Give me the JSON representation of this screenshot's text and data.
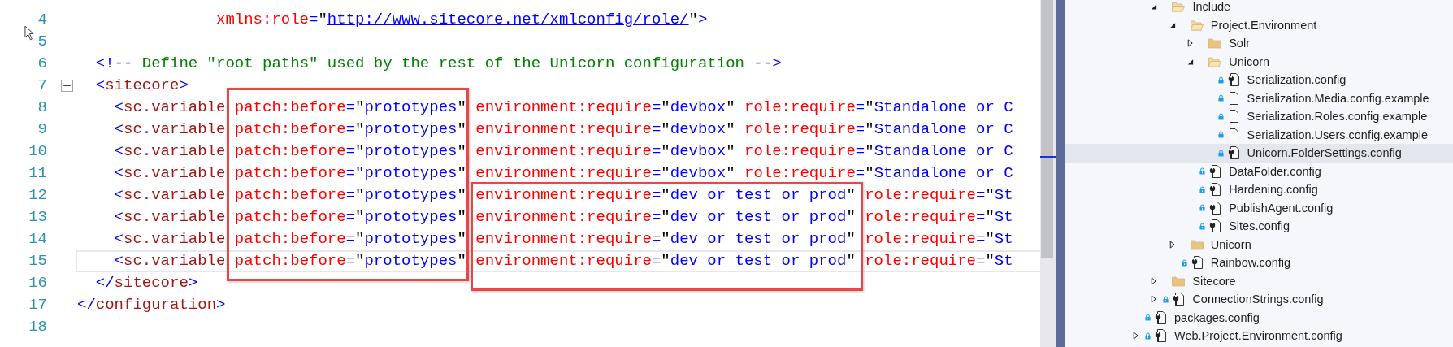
{
  "editor": {
    "lines": [
      {
        "number": "4",
        "current": false,
        "tokens": [
          {
            "kind": "attr",
            "text": "xmlns:role"
          },
          {
            "kind": "delim",
            "text": "="
          },
          {
            "kind": "plain",
            "text": "\""
          },
          {
            "kind": "url",
            "text": "http://www.sitecore.net/xmlconfig/role/"
          },
          {
            "kind": "plain",
            "text": "\""
          },
          {
            "kind": "delim",
            "text": ">"
          }
        ]
      },
      {
        "number": "5",
        "current": false
      },
      {
        "number": "6",
        "current": false,
        "tokens": [
          {
            "kind": "delim",
            "text": "<!--"
          },
          {
            "kind": "comment",
            "text": " Define \"root paths\" used by the rest of the Unicorn configuration "
          },
          {
            "kind": "delim",
            "text": "-->"
          }
        ]
      },
      {
        "number": "7",
        "current": false,
        "fold_expanded": true,
        "tokens": [
          {
            "kind": "delim",
            "text": "<"
          },
          {
            "kind": "tag",
            "text": "sitecore"
          },
          {
            "kind": "delim",
            "text": ">"
          }
        ]
      },
      {
        "number": "8",
        "current": false,
        "tokens": [
          {
            "kind": "delim",
            "text": "<"
          },
          {
            "kind": "tag",
            "text": "sc.variable"
          },
          {
            "kind": "attr",
            "text": "patch:before"
          },
          {
            "kind": "delim",
            "text": "="
          },
          {
            "kind": "plain",
            "text": "\""
          },
          {
            "kind": "value",
            "text": "prototypes"
          },
          {
            "kind": "plain",
            "text": "\" "
          },
          {
            "kind": "attr",
            "text": "environment:require"
          },
          {
            "kind": "delim",
            "text": "="
          },
          {
            "kind": "plain",
            "text": "\""
          },
          {
            "kind": "value",
            "text": "devbox"
          },
          {
            "kind": "plain",
            "text": "\" "
          },
          {
            "kind": "attr",
            "text": "role:require"
          },
          {
            "kind": "delim",
            "text": "="
          },
          {
            "kind": "plain",
            "text": "\""
          },
          {
            "kind": "value",
            "text": "Standalone or C"
          }
        ]
      },
      {
        "number": "9",
        "current": false,
        "tokens": [
          {
            "kind": "delim",
            "text": "<"
          },
          {
            "kind": "tag",
            "text": "sc.variable"
          },
          {
            "kind": "attr",
            "text": "patch:before"
          },
          {
            "kind": "delim",
            "text": "="
          },
          {
            "kind": "plain",
            "text": "\""
          },
          {
            "kind": "value",
            "text": "prototypes"
          },
          {
            "kind": "plain",
            "text": "\" "
          },
          {
            "kind": "attr",
            "text": "environment:require"
          },
          {
            "kind": "delim",
            "text": "="
          },
          {
            "kind": "plain",
            "text": "\""
          },
          {
            "kind": "value",
            "text": "devbox"
          },
          {
            "kind": "plain",
            "text": "\" "
          },
          {
            "kind": "attr",
            "text": "role:require"
          },
          {
            "kind": "delim",
            "text": "="
          },
          {
            "kind": "plain",
            "text": "\""
          },
          {
            "kind": "value",
            "text": "Standalone or C"
          }
        ]
      },
      {
        "number": "10",
        "current": false,
        "tokens": [
          {
            "kind": "delim",
            "text": "<"
          },
          {
            "kind": "tag",
            "text": "sc.variable"
          },
          {
            "kind": "attr",
            "text": "patch:before"
          },
          {
            "kind": "delim",
            "text": "="
          },
          {
            "kind": "plain",
            "text": "\""
          },
          {
            "kind": "value",
            "text": "prototypes"
          },
          {
            "kind": "plain",
            "text": "\" "
          },
          {
            "kind": "attr",
            "text": "environment:require"
          },
          {
            "kind": "delim",
            "text": "="
          },
          {
            "kind": "plain",
            "text": "\""
          },
          {
            "kind": "value",
            "text": "devbox"
          },
          {
            "kind": "plain",
            "text": "\" "
          },
          {
            "kind": "attr",
            "text": "role:require"
          },
          {
            "kind": "delim",
            "text": "="
          },
          {
            "kind": "plain",
            "text": "\""
          },
          {
            "kind": "value",
            "text": "Standalone or C"
          }
        ]
      },
      {
        "number": "11",
        "current": false,
        "tokens": [
          {
            "kind": "delim",
            "text": "<"
          },
          {
            "kind": "tag",
            "text": "sc.variable"
          },
          {
            "kind": "attr",
            "text": "patch:before"
          },
          {
            "kind": "delim",
            "text": "="
          },
          {
            "kind": "plain",
            "text": "\""
          },
          {
            "kind": "value",
            "text": "prototypes"
          },
          {
            "kind": "plain",
            "text": "\" "
          },
          {
            "kind": "attr",
            "text": "environment:require"
          },
          {
            "kind": "delim",
            "text": "="
          },
          {
            "kind": "plain",
            "text": "\""
          },
          {
            "kind": "value",
            "text": "devbox"
          },
          {
            "kind": "plain",
            "text": "\" "
          },
          {
            "kind": "attr",
            "text": "role:require"
          },
          {
            "kind": "delim",
            "text": "="
          },
          {
            "kind": "plain",
            "text": "\""
          },
          {
            "kind": "value",
            "text": "Standalone or C"
          }
        ]
      },
      {
        "number": "12",
        "current": false,
        "tokens": [
          {
            "kind": "delim",
            "text": "<"
          },
          {
            "kind": "tag",
            "text": "sc.variable"
          },
          {
            "kind": "attr",
            "text": "patch:before"
          },
          {
            "kind": "delim",
            "text": "="
          },
          {
            "kind": "plain",
            "text": "\""
          },
          {
            "kind": "value",
            "text": "prototypes"
          },
          {
            "kind": "plain",
            "text": "\" "
          },
          {
            "kind": "attr",
            "text": "environment:require"
          },
          {
            "kind": "delim",
            "text": "="
          },
          {
            "kind": "plain",
            "text": "\""
          },
          {
            "kind": "value",
            "text": "dev or test or prod"
          },
          {
            "kind": "plain",
            "text": "\" "
          },
          {
            "kind": "attr",
            "text": "role:require"
          },
          {
            "kind": "delim",
            "text": "="
          },
          {
            "kind": "plain",
            "text": "\""
          },
          {
            "kind": "value",
            "text": "St"
          }
        ]
      },
      {
        "number": "13",
        "current": false,
        "tokens": [
          {
            "kind": "delim",
            "text": "<"
          },
          {
            "kind": "tag",
            "text": "sc.variable"
          },
          {
            "kind": "attr",
            "text": "patch:before"
          },
          {
            "kind": "delim",
            "text": "="
          },
          {
            "kind": "plain",
            "text": "\""
          },
          {
            "kind": "value",
            "text": "prototypes"
          },
          {
            "kind": "plain",
            "text": "\" "
          },
          {
            "kind": "attr",
            "text": "environment:require"
          },
          {
            "kind": "delim",
            "text": "="
          },
          {
            "kind": "plain",
            "text": "\""
          },
          {
            "kind": "value",
            "text": "dev or test or prod"
          },
          {
            "kind": "plain",
            "text": "\" "
          },
          {
            "kind": "attr",
            "text": "role:require"
          },
          {
            "kind": "delim",
            "text": "="
          },
          {
            "kind": "plain",
            "text": "\""
          },
          {
            "kind": "value",
            "text": "St"
          }
        ]
      },
      {
        "number": "14",
        "current": false,
        "tokens": [
          {
            "kind": "delim",
            "text": "<"
          },
          {
            "kind": "tag",
            "text": "sc.variable"
          },
          {
            "kind": "attr",
            "text": "patch:before"
          },
          {
            "kind": "delim",
            "text": "="
          },
          {
            "kind": "plain",
            "text": "\""
          },
          {
            "kind": "value",
            "text": "prototypes"
          },
          {
            "kind": "plain",
            "text": "\" "
          },
          {
            "kind": "attr",
            "text": "environment:require"
          },
          {
            "kind": "delim",
            "text": "="
          },
          {
            "kind": "plain",
            "text": "\""
          },
          {
            "kind": "value",
            "text": "dev or test or prod"
          },
          {
            "kind": "plain",
            "text": "\" "
          },
          {
            "kind": "attr",
            "text": "role:require"
          },
          {
            "kind": "delim",
            "text": "="
          },
          {
            "kind": "plain",
            "text": "\""
          },
          {
            "kind": "value",
            "text": "St"
          }
        ]
      },
      {
        "number": "15",
        "current": true,
        "tokens": [
          {
            "kind": "delim",
            "text": "<"
          },
          {
            "kind": "tag",
            "text": "sc.variable"
          },
          {
            "kind": "attr",
            "text": "patch:before"
          },
          {
            "kind": "delim",
            "text": "="
          },
          {
            "kind": "plain",
            "text": "\""
          },
          {
            "kind": "value",
            "text": "prototypes"
          },
          {
            "kind": "plain",
            "text": "\" "
          },
          {
            "kind": "attr",
            "text": "environment:require"
          },
          {
            "kind": "delim",
            "text": "="
          },
          {
            "kind": "plain",
            "text": "\""
          },
          {
            "kind": "value",
            "text": "dev or test or prod"
          },
          {
            "kind": "plain",
            "text": "\" "
          },
          {
            "kind": "attr",
            "text": "role:require"
          },
          {
            "kind": "delim",
            "text": "="
          },
          {
            "kind": "plain",
            "text": "\""
          },
          {
            "kind": "value",
            "text": "St"
          }
        ]
      },
      {
        "number": "16",
        "current": false,
        "tokens": [
          {
            "kind": "delim",
            "text": "</"
          },
          {
            "kind": "tag",
            "text": "sitecore"
          },
          {
            "kind": "delim",
            "text": ">"
          }
        ]
      },
      {
        "number": "17",
        "current": false,
        "tokens": [
          {
            "kind": "delim",
            "text": "</"
          },
          {
            "kind": "tag",
            "text": "configuration"
          },
          {
            "kind": "delim",
            "text": ">"
          }
        ]
      },
      {
        "number": "18",
        "current": false
      }
    ]
  },
  "solution_explorer": {
    "items": [
      {
        "children": [
          {
            "label": "Include",
            "kind": "folder",
            "locked": false,
            "selected": false,
            "expanded": true,
            "children": [
              {
                "label": "Project.Environment",
                "kind": "folder",
                "locked": false,
                "selected": false,
                "expanded": true,
                "children": [
                  {
                    "label": "Solr",
                    "kind": "folder",
                    "locked": false,
                    "selected": false,
                    "expanded": false
                  },
                  {
                    "label": "Unicorn",
                    "kind": "folder",
                    "locked": false,
                    "selected": false,
                    "expanded": true,
                    "children": [
                      {
                        "label": "Serialization.config",
                        "kind": "config",
                        "locked": true,
                        "selected": false
                      },
                      {
                        "label": "Serialization.Media.config.example",
                        "kind": "file",
                        "locked": true,
                        "selected": false
                      },
                      {
                        "label": "Serialization.Roles.config.example",
                        "kind": "file",
                        "locked": true,
                        "selected": false
                      },
                      {
                        "label": "Serialization.Users.config.example",
                        "kind": "file",
                        "locked": true,
                        "selected": false
                      },
                      {
                        "label": "Unicorn.FolderSettings.config",
                        "kind": "config",
                        "locked": true,
                        "selected": true
                      }
                    ]
                  },
                  {
                    "label": "DataFolder.config",
                    "kind": "config",
                    "locked": true,
                    "selected": false
                  },
                  {
                    "label": "Hardening.config",
                    "kind": "config",
                    "locked": true,
                    "selected": false
                  },
                  {
                    "label": "PublishAgent.config",
                    "kind": "config",
                    "locked": true,
                    "selected": false
                  },
                  {
                    "label": "Sites.config",
                    "kind": "config",
                    "locked": true,
                    "selected": false
                  }
                ]
              },
              {
                "label": "Unicorn",
                "kind": "folder",
                "locked": false,
                "selected": false,
                "expanded": false
              },
              {
                "label": "Rainbow.config",
                "kind": "config",
                "locked": true,
                "selected": false
              }
            ]
          },
          {
            "label": "Sitecore",
            "kind": "folder",
            "locked": false,
            "selected": false,
            "expanded": false
          },
          {
            "label": "ConnectionStrings.config",
            "kind": "config",
            "locked": true,
            "selected": false,
            "expanded": false
          }
        ]
      },
      {
        "label": "packages.config",
        "kind": "config",
        "locked": true,
        "selected": false
      },
      {
        "label": "Web.Project.Environment.config",
        "kind": "config",
        "locked": true,
        "selected": false,
        "expanded": false
      }
    ]
  }
}
